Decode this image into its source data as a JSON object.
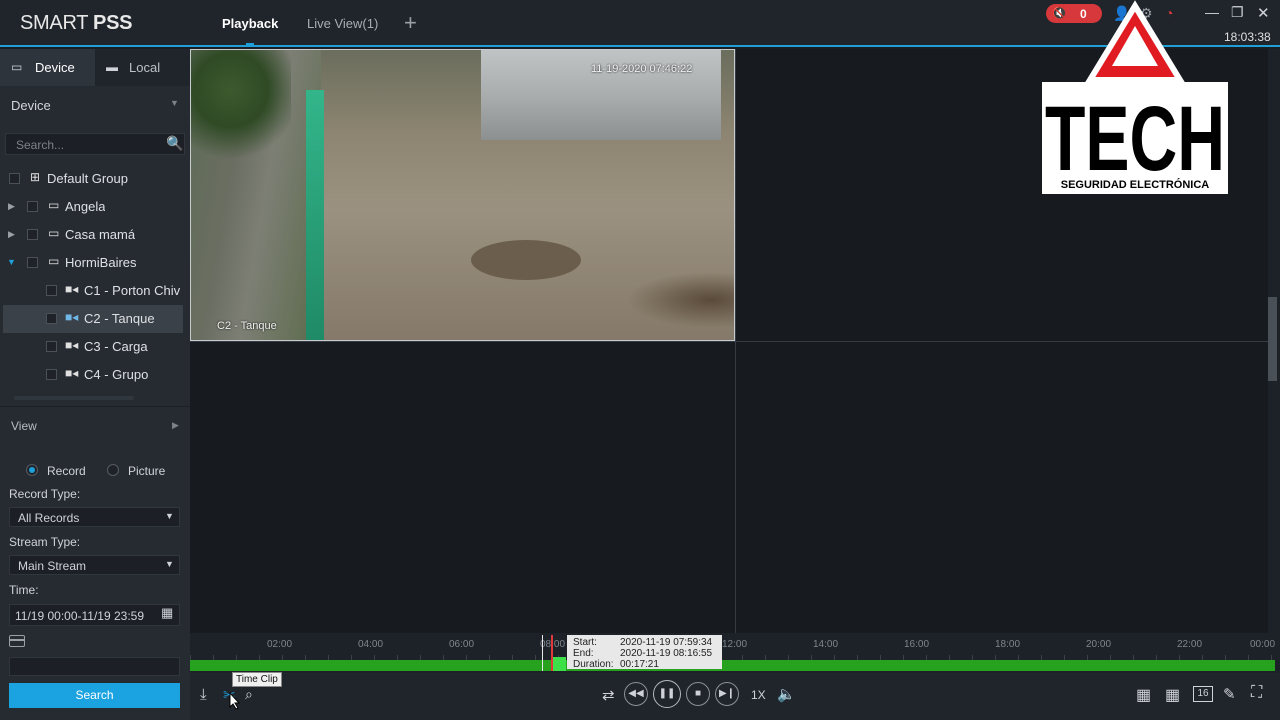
{
  "app": {
    "brand_light": "SMART ",
    "brand_bold": "PSS"
  },
  "tabs": {
    "playback": "Playback",
    "live_view": "Live View(1)",
    "add": "+"
  },
  "top_right": {
    "alarm_count": "0",
    "clock": "18:03:38"
  },
  "watermark": {
    "word": "TECH",
    "tagline": "SEGURIDAD ELECTRÓNICA"
  },
  "left_tabs": {
    "device": "Device",
    "local": "Local"
  },
  "device_header": {
    "label": "Device"
  },
  "search": {
    "placeholder": "Search..."
  },
  "tree": {
    "items": [
      {
        "label": "Default Group",
        "icon": "org-chart-icon"
      },
      {
        "label": "Angela",
        "icon": "nvr-icon"
      },
      {
        "label": "Casa mamá",
        "icon": "nvr-icon"
      },
      {
        "label": "HormiBaires",
        "icon": "nvr-icon"
      },
      {
        "label": "C1 - Porton Chiv",
        "icon": "camera-icon"
      },
      {
        "label": "C2 - Tanque",
        "icon": "camera-icon"
      },
      {
        "label": "C3 - Carga",
        "icon": "camera-icon"
      },
      {
        "label": "C4 - Grupo",
        "icon": "camera-icon"
      }
    ]
  },
  "view_header": {
    "label": "View"
  },
  "record_options": {
    "record": "Record",
    "picture": "Picture",
    "selected": "Record"
  },
  "form": {
    "record_type_label": "Record Type:",
    "record_type_value": "All Records",
    "stream_type_label": "Stream Type:",
    "stream_type_value": "Main Stream",
    "time_label": "Time:",
    "time_value": "11/19 00:00-11/19 23:59",
    "search_button": "Search"
  },
  "video": {
    "timestamp": "11-19-2020 07:46:22",
    "channel_name": "C2 - Tanque"
  },
  "timeline": {
    "ticks": [
      "02:00",
      "04:00",
      "06:00",
      "08:00",
      "12:00",
      "14:00",
      "16:00",
      "18:00",
      "20:00",
      "22:00",
      "00:00"
    ],
    "tooltip": {
      "start_label": "Start:",
      "start_value": "2020-11-19 07:59:34",
      "end_label": "End:",
      "end_value": "2020-11-19 08:16:55",
      "duration_label": "Duration:",
      "duration_value": "00:17:21"
    }
  },
  "controls": {
    "time_clip_tooltip": "Time Clip",
    "speed": "1X",
    "layout_16": "16"
  },
  "colors": {
    "accent": "#1e9fd8",
    "record_bar": "#27a21e",
    "alarm": "#d6383b",
    "search_button": "#1aa3e0"
  }
}
